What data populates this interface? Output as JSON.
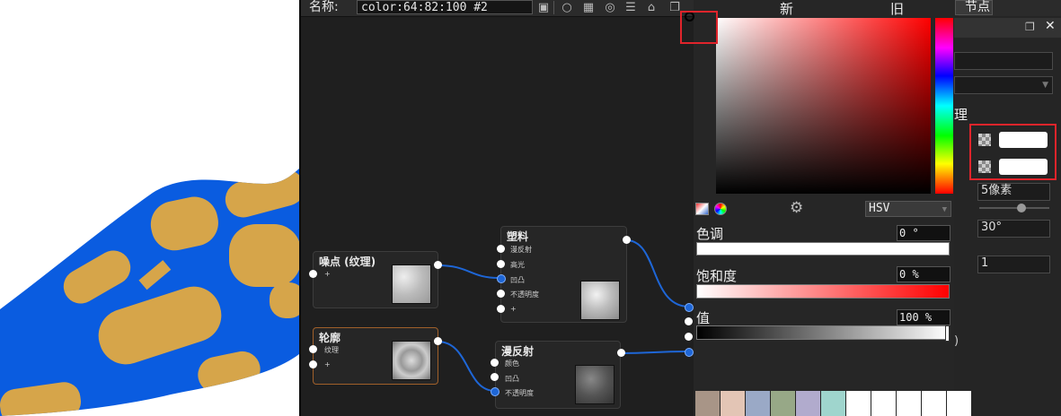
{
  "toolbar": {
    "name_label": "名称:",
    "name_value": "color:64:82:100   #2",
    "new_label": "新",
    "old_label": "旧",
    "node_tab_label": "节点"
  },
  "nodes": {
    "noise": {
      "title": "噪点 (纹理)",
      "ports": [
        "+"
      ]
    },
    "material": {
      "title": "塑料",
      "ports": [
        "漫反射",
        "高光",
        "凹凸",
        "不透明度",
        "+"
      ]
    },
    "outline": {
      "title": "轮廓",
      "ports": [
        "纹理",
        "+"
      ]
    },
    "diffuse": {
      "title": "漫反射",
      "ports": [
        "颜色",
        "凹凸",
        "不透明度"
      ]
    }
  },
  "picker": {
    "mode_value": "HSV",
    "hue_label": "色调",
    "hue_value": "0 °",
    "sat_label": "饱和度",
    "sat_value": "0 %",
    "val_label": "值",
    "val_value": "100 %",
    "swatches": [
      "#a89587",
      "#e3c5b5",
      "#9aa9c6",
      "#97a887",
      "#b1abcd",
      "#9fd5cd",
      "#ffffff",
      "#ffffff",
      "#ffffff",
      "#ffffff",
      "#ffffff"
    ]
  },
  "properties": {
    "texture_label": "理",
    "pixel_value": "5像素",
    "angle_value": "30°",
    "count_value": "1",
    "paren": ")"
  },
  "colors": {
    "surface_blue": "#0a5ce0",
    "surface_spots": "#d6a54a",
    "highlight_box": "#e0242b",
    "link_blue": "#1e66d6"
  }
}
